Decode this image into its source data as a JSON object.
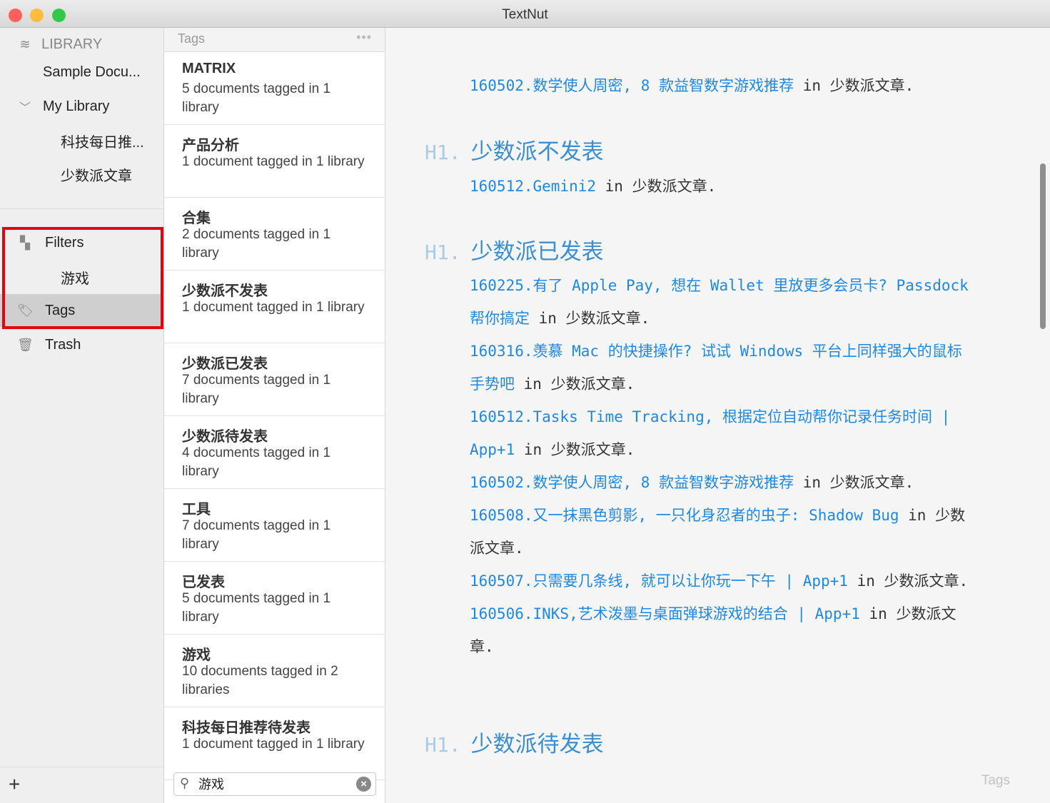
{
  "window": {
    "title": "TextNut",
    "traffic_colors": [
      "#fc605c",
      "#fdbc40",
      "#34c84a"
    ]
  },
  "sidebar": {
    "library_label": "LIBRARY",
    "items": [
      {
        "label": "Sample Docu..."
      },
      {
        "label": "My Library"
      },
      {
        "label": "科技每日推..."
      },
      {
        "label": "少数派文章"
      },
      {
        "label": "Filters"
      },
      {
        "label": "游戏"
      },
      {
        "label": "Tags"
      },
      {
        "label": "Trash"
      }
    ],
    "add_label": "+",
    "highlight_color": "#e8000b"
  },
  "tags_panel": {
    "header": "Tags",
    "more": "•••",
    "rows": [
      {
        "title": "MATRIX",
        "desc": "5 documents tagged in 1 library"
      },
      {
        "title": "产品分析",
        "desc": "1 document tagged in 1 library"
      },
      {
        "title": "合集",
        "desc": "2 documents tagged in 1 library"
      },
      {
        "title": "少数派不发表",
        "desc": "1 document tagged in 1 library"
      },
      {
        "title": "少数派已发表",
        "desc": "7 documents tagged in 1 library"
      },
      {
        "title": "少数派待发表",
        "desc": "4 documents tagged in 1 library"
      },
      {
        "title": "工具",
        "desc": "7 documents tagged in 1 library"
      },
      {
        "title": "已发表",
        "desc": "5 documents tagged in 1 library"
      },
      {
        "title": "游戏",
        "desc": "10 documents tagged in 2 libraries"
      },
      {
        "title": "科技每日推荐待发表",
        "desc": "1 document tagged in 1 library"
      }
    ],
    "search": {
      "value": "游戏"
    }
  },
  "editor": {
    "link_color": "#1e88e5",
    "heading_marker": "H1.",
    "entries": [
      {
        "link": "160502.数学使人周密, 8 款益智数字游戏推荐",
        "suffix": " in 少数派文章."
      },
      {
        "link": "160512.Gemini2",
        "suffix": " in 少数派文章."
      },
      {
        "link": "160225.有了 Apple Pay, 想在 Wallet 里放更多会员卡? Passdock 帮你搞定",
        "suffix": " in 少数派文章."
      },
      {
        "link": "160316.羡慕 Mac 的快捷操作? 试试 Windows 平台上同样强大的鼠标手势吧",
        "suffix": " in 少数派文章."
      },
      {
        "link": "160512.Tasks Time Tracking, 根据定位自动帮你记录任务时间 | App+1",
        "suffix": " in 少数派文章."
      },
      {
        "link": "160502.数学使人周密, 8 款益智数字游戏推荐",
        "suffix": " in 少数派文章."
      },
      {
        "link": "160508.又一抹黑色剪影, 一只化身忍者的虫子: Shadow Bug",
        "suffix": " in 少数派文章."
      },
      {
        "link": "160507.只需要几条线, 就可以让你玩一下午 | App+1",
        "suffix": " in 少数派文章."
      },
      {
        "link": "160506.INKS,艺术泼墨与桌面弹球游戏的结合 | App+1",
        "suffix": " in 少数派文章."
      }
    ],
    "headings": [
      "少数派不发表",
      "少数派已发表",
      "少数派待发表"
    ],
    "footer_label": "Tags"
  }
}
